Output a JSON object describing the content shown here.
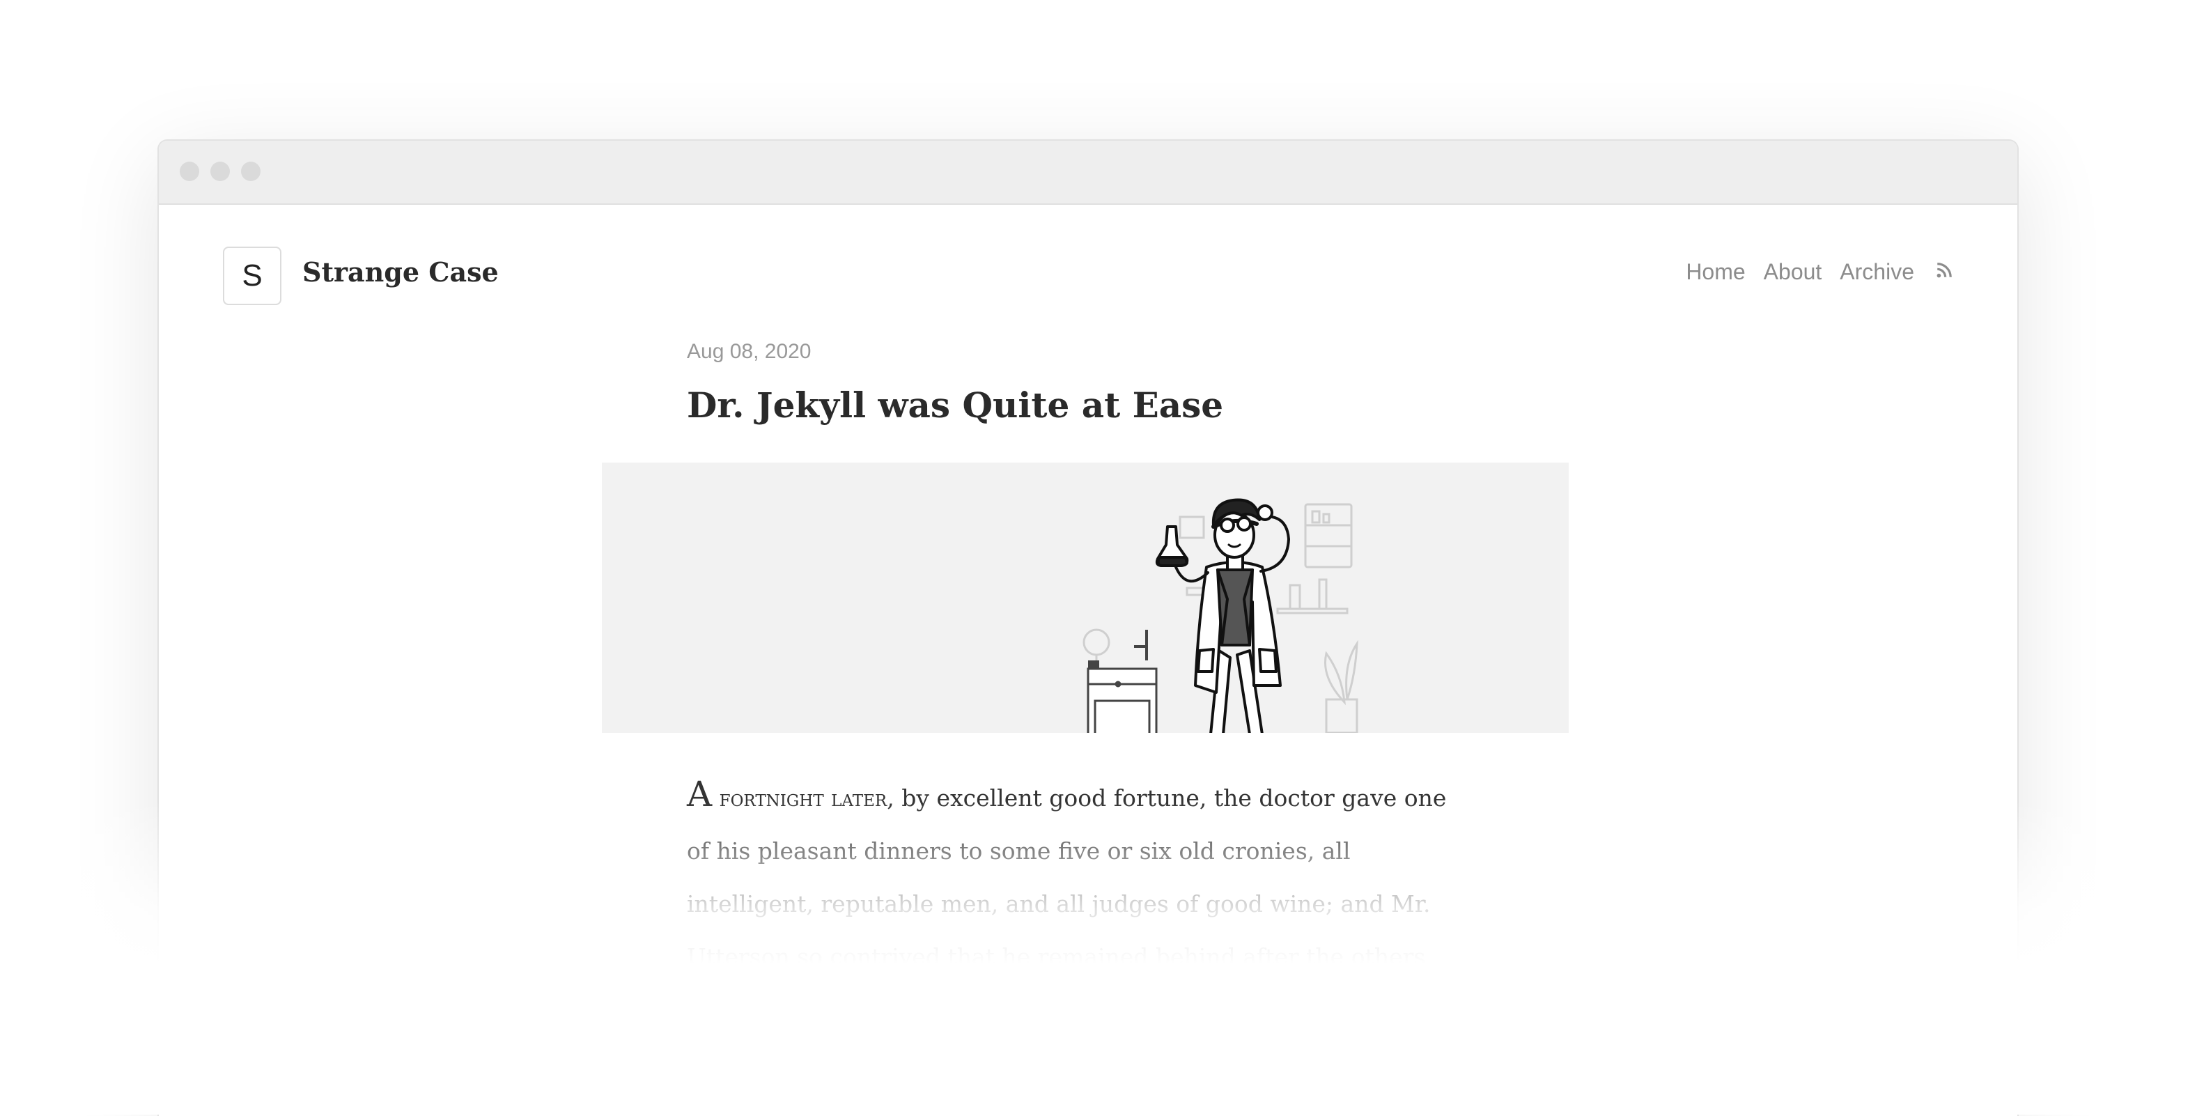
{
  "site": {
    "logo_letter": "S",
    "title": "Strange Case"
  },
  "nav": {
    "items": [
      {
        "label": "Home"
      },
      {
        "label": "About"
      },
      {
        "label": "Archive"
      }
    ],
    "rss_icon": "rss-icon"
  },
  "post": {
    "date": "Aug 08, 2020",
    "title": "Dr. Jekyll was Quite at Ease",
    "hero_image": "scientist-illustration",
    "dropcap": "A",
    "smallcaps_lead": "fortnight later",
    "body_rest": ", by excellent good fortune, the doctor gave one of his pleasant dinners to some five or six old cronies, all intelligent, reputable men, and all judges of good wine; and Mr. Utterson so contrived that he remained behind after the others had departed. This"
  },
  "colors": {
    "text": "#2a2a2a",
    "muted": "#8c8c8c",
    "titlebar": "#eeeeee",
    "hero_bg": "#f2f2f2"
  }
}
